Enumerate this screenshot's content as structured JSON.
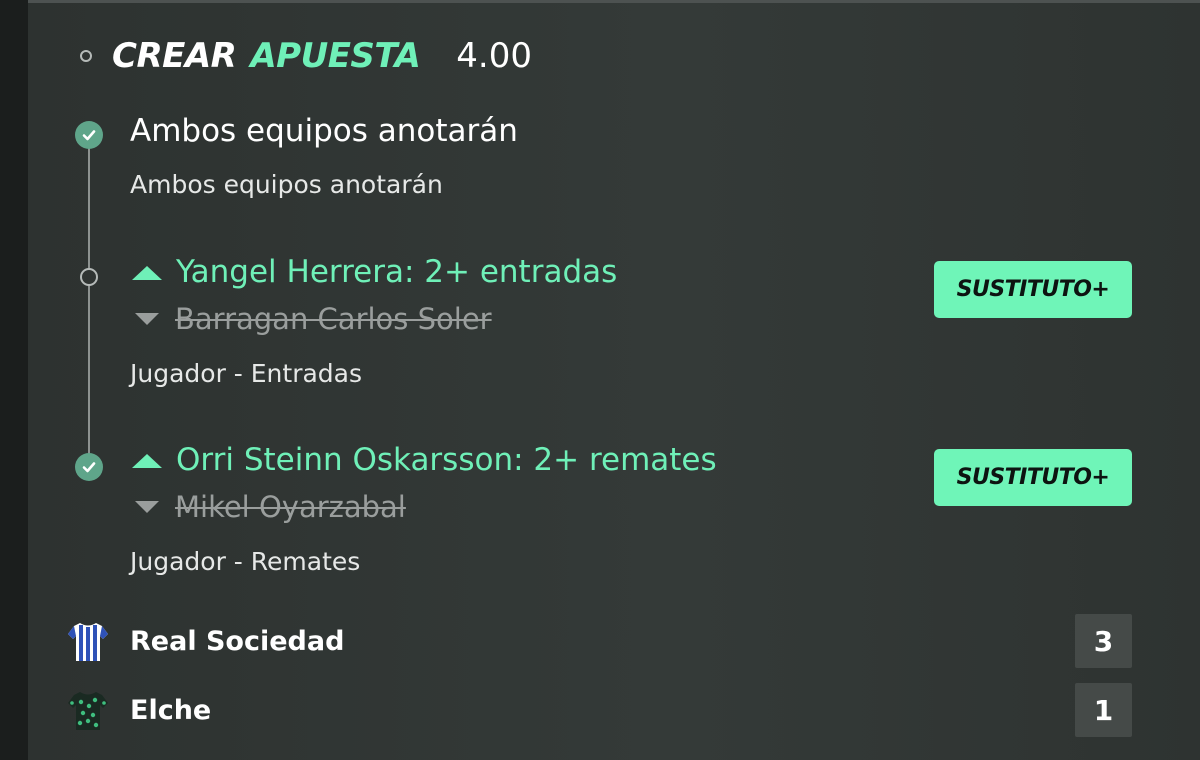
{
  "header": {
    "title_part1": "CREAR",
    "title_part2": "APUESTA",
    "odds": "4.00"
  },
  "selections": [
    {
      "status": "won",
      "title": "Ambos equipos anotarán",
      "market": "Ambos equipos anotarán"
    },
    {
      "status": "pending",
      "substitute_in": "Yangel Herrera: 2+ entradas",
      "substitute_out": "Barragan Carlos Soler",
      "market": "Jugador - Entradas",
      "badge": "SUSTITUTO+"
    },
    {
      "status": "won",
      "substitute_in": "Orri Steinn Oskarsson: 2+ remates",
      "substitute_out": "Mikel Oyarzabal",
      "market": "Jugador - Remates",
      "badge": "SUSTITUTO+"
    }
  ],
  "match": {
    "home": {
      "name": "Real Sociedad",
      "score": "3",
      "icon": "real-sociedad-shirt-icon"
    },
    "away": {
      "name": "Elche",
      "score": "1",
      "icon": "elche-shirt-icon"
    }
  },
  "colors": {
    "accent_green": "#6ff0b8",
    "badge_green": "#6ff5b8",
    "check_green": "#5fa58a",
    "struck_grey": "#9a9e9d",
    "card_bg": "#343a38"
  }
}
